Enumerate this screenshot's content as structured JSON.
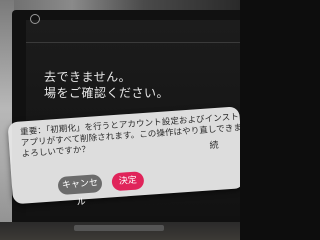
{
  "screen": {
    "background_lines": [
      "去できません。",
      "場をご確認ください。"
    ]
  },
  "dialog": {
    "message_lines": [
      "重要：「初期化」を行うとアカウント設定およびインストール済み",
      "アプリがすべて削除されます。この操作はやり直しできません。",
      "よろしいですか？"
    ],
    "continue_label": "続",
    "cancel_label": "キャンセル",
    "ok_label": "決定"
  },
  "colors": {
    "ok_button": "#e0245a",
    "cancel_button": "#6b6b6b",
    "dialog_bg": "#e4e4e4"
  }
}
